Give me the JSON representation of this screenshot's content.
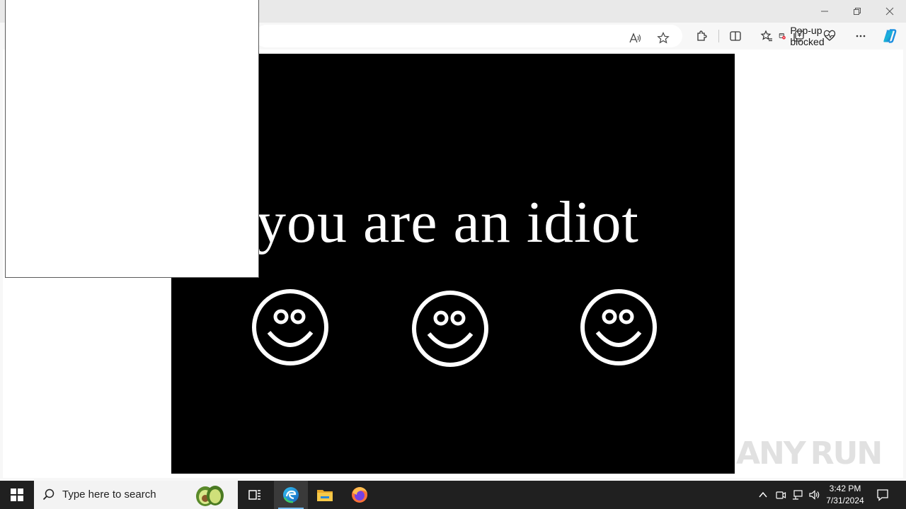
{
  "browser": {
    "popup_blocked_label": "Pop-up blocked",
    "window_controls": [
      "minimize",
      "restore",
      "close"
    ]
  },
  "page": {
    "headline": "you are an idiot",
    "smileys": [
      "smiley-face-icon",
      "smiley-face-icon",
      "smiley-face-icon"
    ],
    "background_color": "#000000",
    "text_color": "#ffffff"
  },
  "watermark": {
    "text_left": "ANY",
    "text_right": "RUN"
  },
  "taskbar": {
    "search_placeholder": "Type here to search",
    "apps": [
      "task-view-icon",
      "edge-icon",
      "file-explorer-icon",
      "firefox-icon"
    ],
    "active_app": "edge-icon"
  },
  "clock": {
    "time": "3:42 PM",
    "date": "7/31/2024"
  }
}
